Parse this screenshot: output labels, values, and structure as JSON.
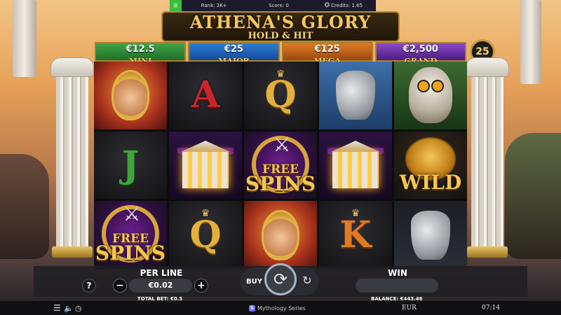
{
  "topbar": {
    "rank": "Rank: 3K+",
    "score": "Score: 0",
    "credits": "Credits: 1.65"
  },
  "header": {
    "title": "ATHENA'S GLORY",
    "subtitle": "HOLD & HIT"
  },
  "jackpots": {
    "mini": {
      "value": "€12.5",
      "label": "MINI",
      "color": "#3fa547"
    },
    "major": {
      "value": "€25",
      "label": "MAJOR",
      "color": "#2c7ed4"
    },
    "mega": {
      "value": "€125",
      "label": "MEGA",
      "color": "#e07b24"
    },
    "grand": {
      "value": "€2,500",
      "label": "GRAND",
      "color": "#8c49c9"
    }
  },
  "lines_count": "25",
  "reels": [
    [
      "athena",
      "J",
      "free_spins"
    ],
    [
      "A",
      "temple",
      "Q"
    ],
    [
      "Q",
      "free_spins",
      "athena"
    ],
    [
      "vase",
      "temple",
      "K"
    ],
    [
      "owl",
      "wild",
      "vase"
    ]
  ],
  "symbols": {
    "A": "A",
    "Q": "Q",
    "J": "J",
    "K": "K",
    "free_spins_line1": "FREE",
    "free_spins_line2": "SPINS",
    "wild": "WILD"
  },
  "controls": {
    "help": "?",
    "per_line_label": "PER LINE",
    "bet_value": "€0.02",
    "minus": "−",
    "plus": "+",
    "total_bet": "TOTAL BET: €0.5",
    "buy_label": "BUY",
    "win_label": "WIN",
    "win_value": "",
    "balance": "BALANCE: €443.46"
  },
  "footer": {
    "series": "Mythology Series",
    "currency": "EUR",
    "time": "07:14"
  },
  "icons": {
    "trophy": "trophy-icon",
    "star": "star-icon",
    "menu": "menu-icon",
    "sound": "speaker-icon",
    "clock": "clock-icon",
    "spin": "spin-icon",
    "autoplay": "autoplay-icon"
  }
}
